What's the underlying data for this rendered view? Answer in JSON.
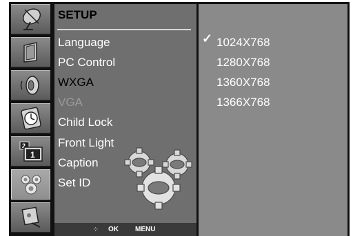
{
  "menu": {
    "title": "SETUP",
    "items": [
      {
        "label": "Language",
        "state": "normal"
      },
      {
        "label": "PC Control",
        "state": "normal"
      },
      {
        "label": "WXGA",
        "state": "active"
      },
      {
        "label": "VGA",
        "state": "disabled"
      },
      {
        "label": "Child Lock",
        "state": "normal"
      },
      {
        "label": "Front Light",
        "state": "normal"
      },
      {
        "label": "Caption",
        "state": "normal"
      },
      {
        "label": "Set ID",
        "state": "normal"
      }
    ]
  },
  "submenu": {
    "check": "✓",
    "options": [
      "1024X768",
      "1280X768",
      "1360X768",
      "1366X768"
    ],
    "selected_index": 0
  },
  "footer": {
    "nav_glyph": "⁘",
    "ok_label": "OK",
    "menu_label": "MENU"
  },
  "icons": [
    "satellite-dish-icon",
    "picture-icon",
    "sound-icon",
    "clock-icon",
    "pip-icon",
    "setup-gears-icon",
    "input-icon"
  ],
  "colors": {
    "menu_bg": "#6f6f6f",
    "sub_bg": "#8a8a8a",
    "active_text": "#000000",
    "disabled_text": "#9a9a9a"
  }
}
